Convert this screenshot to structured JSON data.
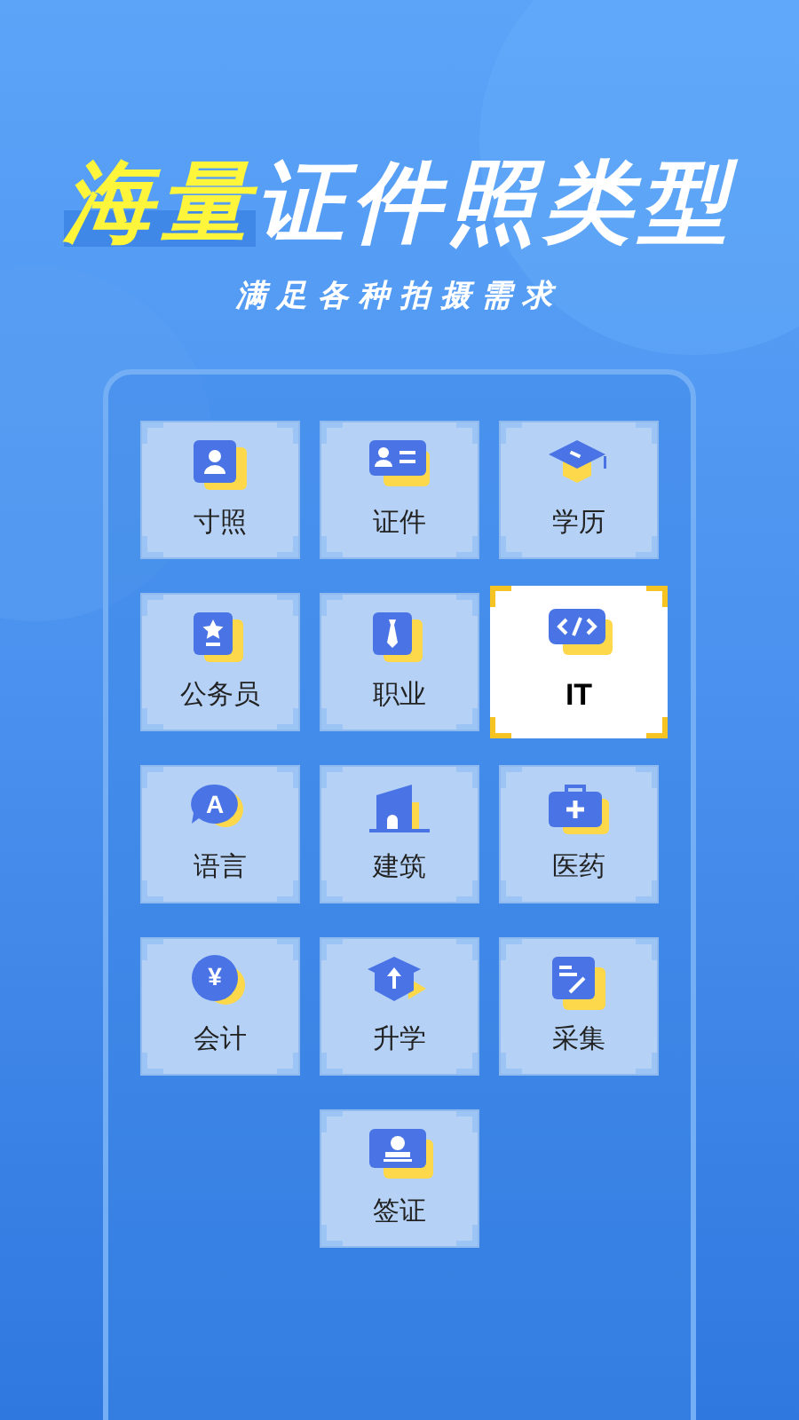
{
  "headline": {
    "highlight": "海量",
    "rest": "证件照类型"
  },
  "subtitle": "满足各种拍摄需求",
  "categories": [
    {
      "label": "寸照",
      "kind": "portrait",
      "selected": false
    },
    {
      "label": "证件",
      "kind": "idcard",
      "selected": false
    },
    {
      "label": "学历",
      "kind": "cap",
      "selected": false
    },
    {
      "label": "公务员",
      "kind": "badge",
      "selected": false
    },
    {
      "label": "职业",
      "kind": "tie",
      "selected": false
    },
    {
      "label": "IT",
      "kind": "code",
      "selected": true
    },
    {
      "label": "语言",
      "kind": "bubble",
      "glyph": "A",
      "selected": false
    },
    {
      "label": "建筑",
      "kind": "building",
      "selected": false
    },
    {
      "label": "医药",
      "kind": "medkit",
      "selected": false
    },
    {
      "label": "会计",
      "kind": "coin",
      "glyph": "¥",
      "selected": false
    },
    {
      "label": "升学",
      "kind": "upcap",
      "selected": false
    },
    {
      "label": "采集",
      "kind": "form",
      "selected": false
    },
    {
      "label": "签证",
      "kind": "stamp",
      "selected": false
    }
  ]
}
